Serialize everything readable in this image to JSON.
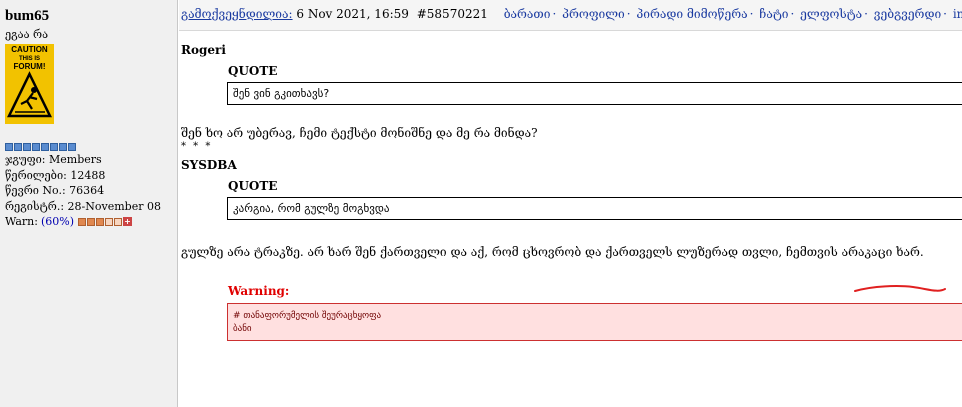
{
  "user": {
    "username": "bum65",
    "title": "ეგაა რა",
    "avatar_text": [
      "CAUTION",
      "THIS IS",
      "FORUM!"
    ],
    "group": "ჯგუფი: Members",
    "posts": "წერილები: 12488",
    "member_no": "წევრი No.: 76364",
    "registered": "რეგისტრ.: 28-November 08",
    "warn_label": "Warn:",
    "warn_pct": "(60%)",
    "warn_level": 0.6
  },
  "post": {
    "published_label": "გამოქვეყნდილია:",
    "date": "6 Nov 2021, 16:59",
    "post_id": "#58570221",
    "nav": [
      "ბარათი",
      "პროფილი",
      "პირადი მიმოწერა",
      "ჩატი",
      "ელფოსტა",
      "ვებგვერდი",
      "im"
    ]
  },
  "content": {
    "quote1_author": "Rogeri",
    "quote1_label": "QUOTE",
    "quote1_text": "შენ ვინ გკითხავს?",
    "reply1": "შენ ხო არ უბერავ, ჩემი ტექსტი მონიშნე და მე რა მინდა?",
    "stars": "* * *",
    "quote2_author": "SYSDBA",
    "quote2_label": "QUOTE",
    "quote2_text": "კარგია, რომ გულზე მოგხვდა",
    "reply2": "გულზე არა ტრაკზე. არ ხარ შენ ქართველი და აქ, რომ ცხოვრობ და ქართველს ლუზერად თვლი, ჩემთვის არაკაცი ხარ.",
    "warning_label": "Warning:",
    "warning_line1": "# თანაფორუმელის შეურაცხყოფა",
    "warning_line2": "ბანი"
  }
}
